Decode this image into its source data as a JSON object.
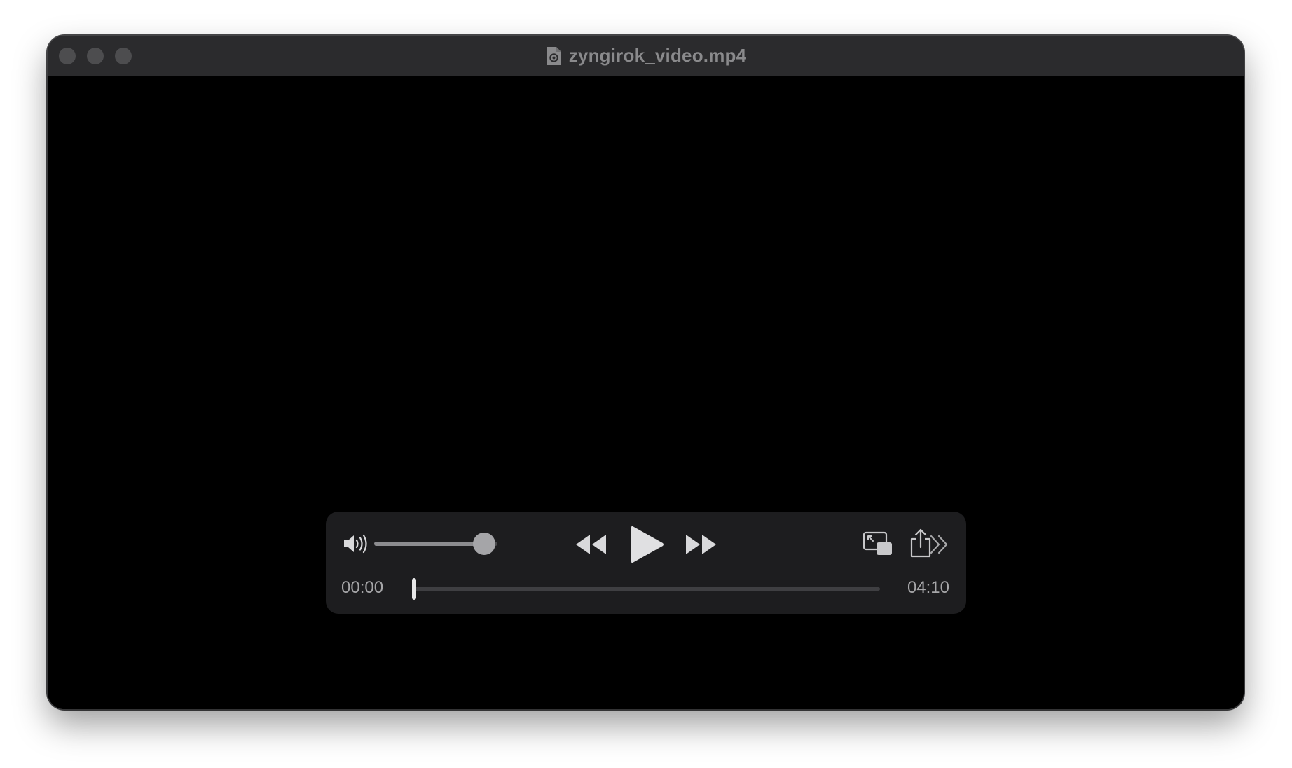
{
  "window": {
    "title": "zyngirok_video.mp4",
    "file_icon": "document-video-icon"
  },
  "traffic_lights": [
    {
      "name": "close",
      "color": "#4d4d4f"
    },
    {
      "name": "minimize",
      "color": "#4d4d4f"
    },
    {
      "name": "zoom",
      "color": "#4d4d4f"
    }
  ],
  "player": {
    "volume_level": 0.89,
    "playback_progress": 0.0,
    "current_time": "00:00",
    "duration": "04:10",
    "state": "paused",
    "icons": {
      "volume": "speaker-volume-icon",
      "rewind": "rewind-icon",
      "play": "play-icon",
      "forward": "fast-forward-icon",
      "pip": "picture-in-picture-icon",
      "share": "share-icon",
      "more": "chevron-double-right-icon"
    }
  },
  "colors": {
    "video_background": "#000000",
    "titlebar": "#2b2b2d",
    "control_panel": "#1d1d1f",
    "control_icon": "#d9d9db"
  }
}
